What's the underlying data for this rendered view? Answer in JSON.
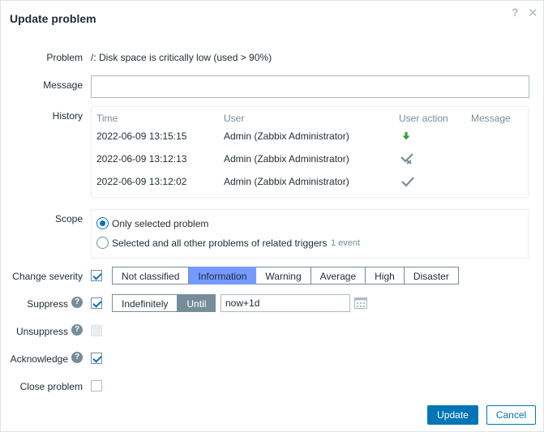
{
  "dialog": {
    "title": "Update problem",
    "help_glyph": "?",
    "close_glyph": "✕"
  },
  "labels": {
    "problem": "Problem",
    "message": "Message",
    "history": "History",
    "scope": "Scope",
    "change_severity": "Change severity",
    "suppress": "Suppress",
    "unsuppress": "Unsuppress",
    "acknowledge": "Acknowledge",
    "close_problem": "Close problem"
  },
  "problem": {
    "text": "/: Disk space is critically low (used > 90%)"
  },
  "message": {
    "value": "",
    "placeholder": ""
  },
  "history": {
    "columns": [
      "Time",
      "User",
      "User action",
      "Message"
    ],
    "rows": [
      {
        "time": "2022-06-09 13:15:15",
        "user": "Admin (Zabbix Administrator)",
        "action_icon": "arrow-down-icon",
        "message": ""
      },
      {
        "time": "2022-06-09 13:12:13",
        "user": "Admin (Zabbix Administrator)",
        "action_icon": "unacknowledge-icon",
        "message": ""
      },
      {
        "time": "2022-06-09 13:12:02",
        "user": "Admin (Zabbix Administrator)",
        "action_icon": "check-icon",
        "message": ""
      }
    ]
  },
  "scope": {
    "options": [
      {
        "label": "Only selected problem",
        "selected": true
      },
      {
        "label": "Selected and all other problems of related triggers",
        "selected": false,
        "note": "1 event"
      }
    ]
  },
  "severity": {
    "enabled": true,
    "options": [
      "Not classified",
      "Information",
      "Warning",
      "Average",
      "High",
      "Disaster"
    ],
    "selected": "Information"
  },
  "suppress": {
    "enabled": true,
    "options": [
      "Indefinitely",
      "Until"
    ],
    "selected": "Until",
    "until_value": "now+1d"
  },
  "unsuppress": {
    "enabled": false,
    "disabled": true
  },
  "acknowledge": {
    "enabled": true
  },
  "close_problem": {
    "enabled": false
  },
  "buttons": {
    "update": "Update",
    "cancel": "Cancel"
  },
  "colors": {
    "accent": "#0275b8",
    "severity_selected": "#7499ff",
    "until_selected": "#768d99",
    "action_green": "#3a9a3a"
  }
}
